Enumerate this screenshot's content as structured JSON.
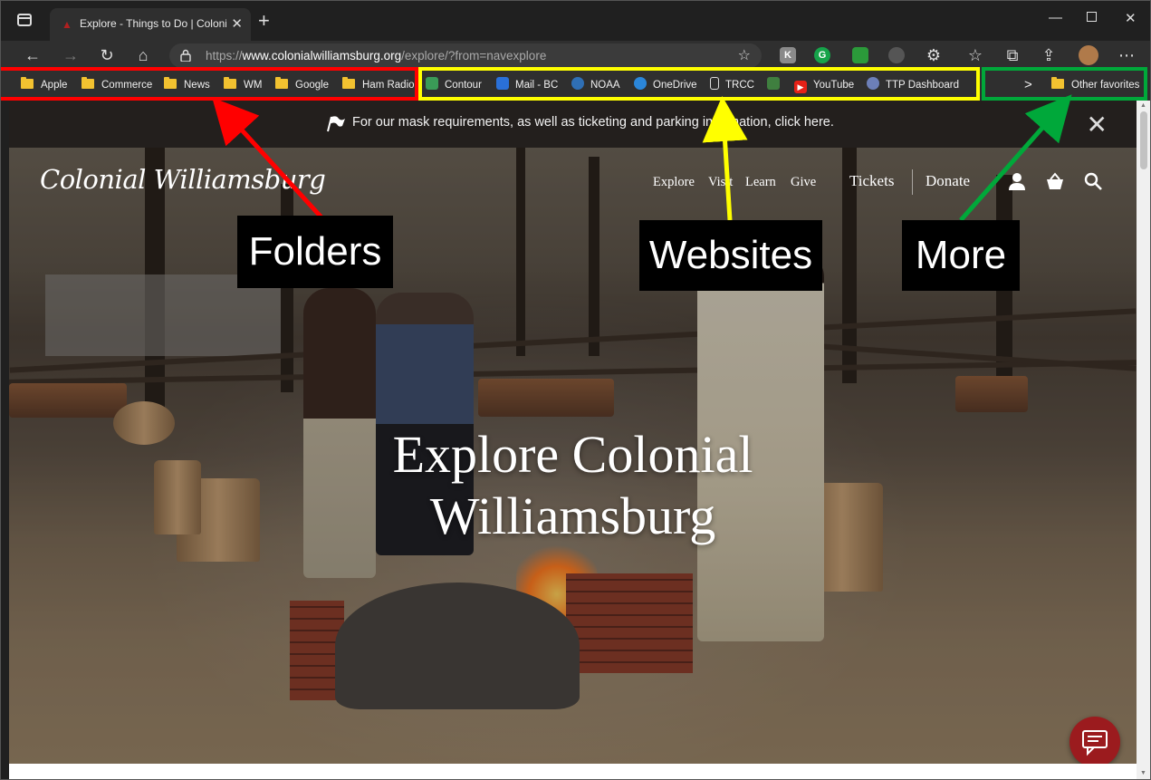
{
  "browser": {
    "tab_title": "Explore - Things to Do | Colonial",
    "url_prefix": "https://",
    "url_domain": "www.colonialwilliamsburg.org",
    "url_path": "/explore/?from=navexplore",
    "ext_g": "G",
    "ext_k": "K"
  },
  "favorites": {
    "folders": [
      "Apple",
      "Commerce",
      "News",
      "WM",
      "Google",
      "Ham Radio"
    ],
    "sites": [
      {
        "label": "Contour",
        "color": "#3a9b57"
      },
      {
        "label": "Mail - BC",
        "color": "#2a70d8"
      },
      {
        "label": "NOAA",
        "color": "#2f6fb5"
      },
      {
        "label": "OneDrive",
        "color": "#2b86d9"
      },
      {
        "label": "TRCC",
        "color": "#666666"
      },
      {
        "label": "",
        "color": "#3f7f3f"
      },
      {
        "label": "YouTube",
        "color": "#e62117"
      },
      {
        "label": "TTP Dashboard",
        "color": "#6c7fb8"
      }
    ],
    "more_chevron": ">",
    "other_favorites": "Other favorites"
  },
  "page": {
    "banner_text": "For our mask requirements, as well as ticketing and parking information, click here.",
    "logo_text": "Colonial Williamsburg",
    "nav": [
      "Explore",
      "Visit",
      "Learn",
      "Give"
    ],
    "tickets": "Tickets",
    "donate": "Donate",
    "hero_line1": "Explore Colonial",
    "hero_line2": "Williamsburg"
  },
  "annotations": {
    "folders": "Folders",
    "websites": "Websites",
    "more": "More",
    "colors": {
      "folders": "#ff0000",
      "websites": "#ffff00",
      "more": "#00a83a"
    }
  }
}
